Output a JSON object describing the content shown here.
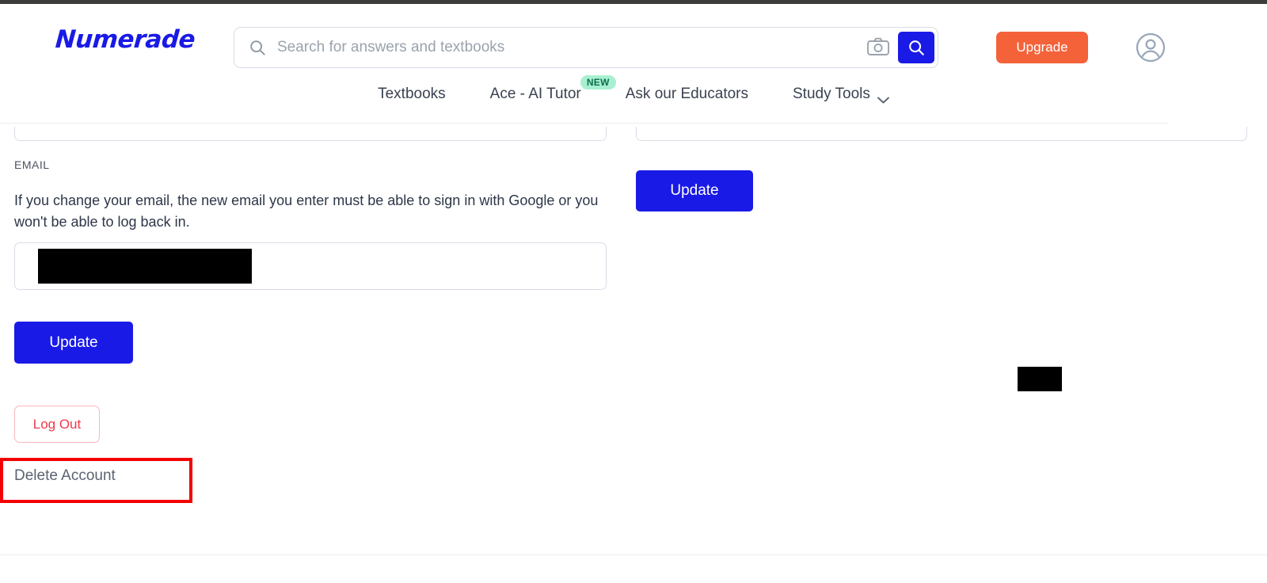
{
  "colors": {
    "brand_blue": "#1a1ae6",
    "upgrade_orange": "#f4623a",
    "badge_mint": "#a8f0d1",
    "badge_text": "#0d6e4c",
    "danger_red": "#f0374a",
    "annotation_red": "#f40000",
    "text_dark": "#2d3748",
    "border_gray": "#d7dde5"
  },
  "header": {
    "logo_text": "Numerade",
    "search": {
      "placeholder": "Search for answers and textbooks",
      "value": "",
      "search_icon": "search-icon",
      "camera_icon": "camera-icon",
      "submit_icon": "search-icon"
    },
    "upgrade_label": "Upgrade",
    "account_icon": "account-circle-icon",
    "nav": [
      {
        "label": "Textbooks",
        "badge": null,
        "caret": false
      },
      {
        "label": "Ace - AI Tutor",
        "badge": "NEW",
        "caret": false
      },
      {
        "label": "Ask our Educators",
        "badge": null,
        "caret": false
      },
      {
        "label": "Study Tools",
        "badge": null,
        "caret": true
      }
    ]
  },
  "main": {
    "left_column": {
      "top_field_value": "",
      "email_label": "EMAIL",
      "email_help": "If you change your email, the new email you enter must be able to sign in with Google or you won't be able to log back in.",
      "email_value": "",
      "update_label": "Update",
      "logout_label": "Log Out",
      "delete_label": "Delete Account"
    },
    "right_column": {
      "top_field_value": "",
      "update_label": "Update"
    }
  }
}
